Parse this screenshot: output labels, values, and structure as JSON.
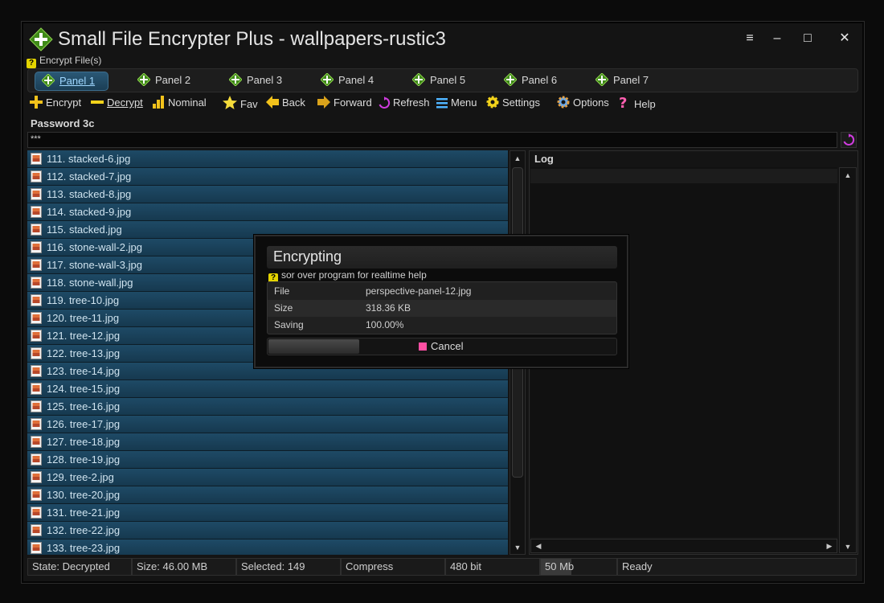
{
  "window": {
    "title": "Small File Encrypter Plus - wallpapers-rustic3",
    "controls": {
      "menu": "≡",
      "minimize": "–",
      "maximize": "□",
      "close": "✕"
    }
  },
  "hint_bar": {
    "text": "Encrypt File(s)"
  },
  "tabs": [
    {
      "label": "Panel 1",
      "active": true
    },
    {
      "label": "Panel 2",
      "active": false
    },
    {
      "label": "Panel 3",
      "active": false
    },
    {
      "label": "Panel 4",
      "active": false
    },
    {
      "label": "Panel 5",
      "active": false
    },
    {
      "label": "Panel 6",
      "active": false
    },
    {
      "label": "Panel 7",
      "active": false
    }
  ],
  "toolbar": {
    "encrypt": "Encrypt",
    "decrypt": "Decrypt",
    "nominal": "Nominal",
    "fav": "Fav",
    "back": "Back",
    "forward": "Forward",
    "refresh": "Refresh",
    "menu": "Menu",
    "settings": "Settings",
    "options": "Options",
    "help": "Help"
  },
  "password": {
    "label": "Password 3c",
    "value": "***"
  },
  "files": [
    "111. stacked-6.jpg",
    "112. stacked-7.jpg",
    "113. stacked-8.jpg",
    "114. stacked-9.jpg",
    "115. stacked.jpg",
    "116. stone-wall-2.jpg",
    "117. stone-wall-3.jpg",
    "118. stone-wall.jpg",
    "119. tree-10.jpg",
    "120. tree-11.jpg",
    "121. tree-12.jpg",
    "122. tree-13.jpg",
    "123. tree-14.jpg",
    "124. tree-15.jpg",
    "125. tree-16.jpg",
    "126. tree-17.jpg",
    "127. tree-18.jpg",
    "128. tree-19.jpg",
    "129. tree-2.jpg",
    "130. tree-20.jpg",
    "131. tree-21.jpg",
    "132. tree-22.jpg",
    "133. tree-23.jpg"
  ],
  "log": {
    "title": "Log"
  },
  "status": {
    "state": "State: Decrypted",
    "size": "Size: 46.00 MB",
    "selected": "Selected: 149",
    "mode": "Compress",
    "bits": "480 bit",
    "memory": "50 Mb",
    "memory_fill_fraction": 0.4,
    "ready": "Ready"
  },
  "dialog": {
    "title": "Encrypting",
    "hint": "sor over program for realtime help",
    "rows": [
      {
        "key": "File",
        "value": "perspective-panel-12.jpg"
      },
      {
        "key": "Size",
        "value": "318.36 KB"
      },
      {
        "key": "Saving",
        "value": "100.00%"
      }
    ],
    "progress_fraction": 0.26,
    "cancel_label": "Cancel"
  },
  "colors": {
    "row_bg": "#1e4a66",
    "accent_green": "#5fb82a",
    "cancel_pink": "#ff4fa3"
  }
}
